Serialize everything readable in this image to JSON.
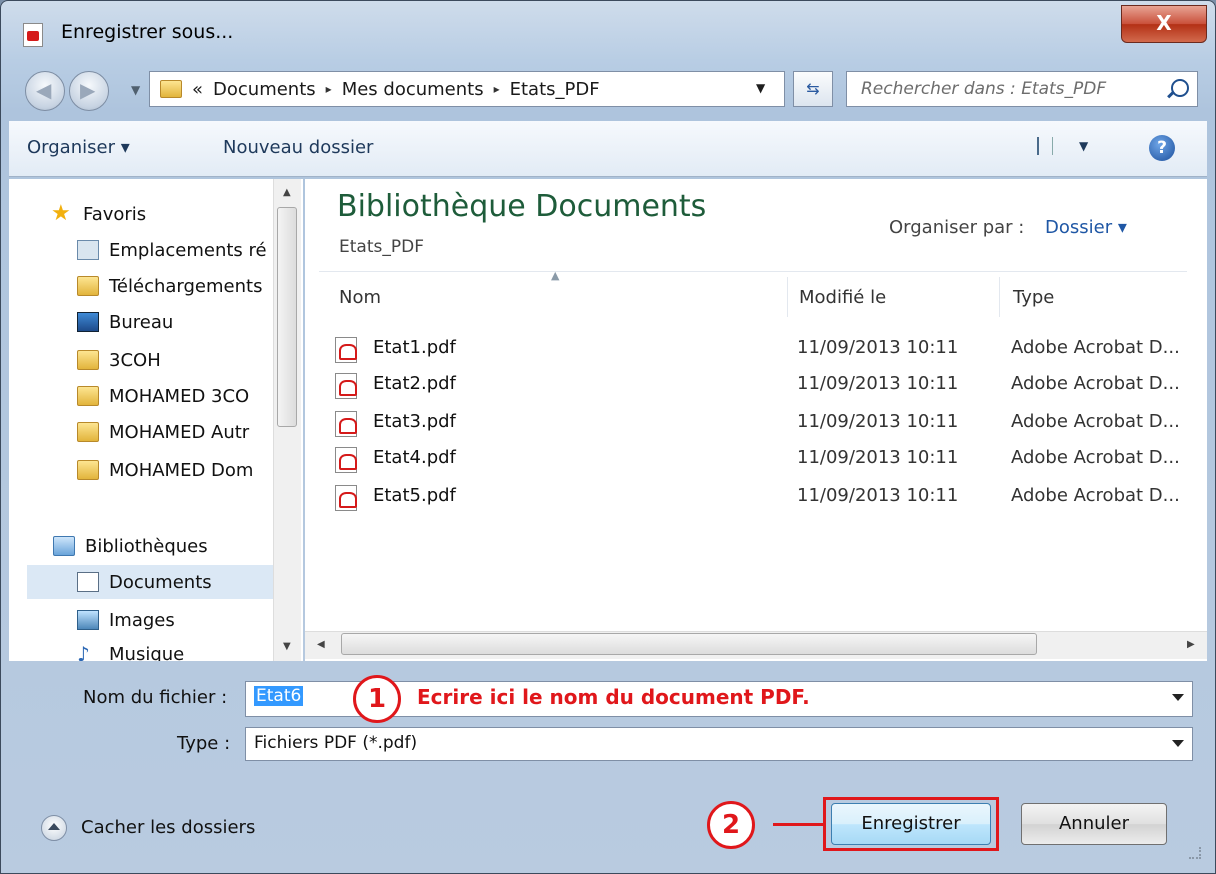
{
  "window": {
    "title": "Enregistrer sous...",
    "close_label": "X"
  },
  "address": {
    "crumbs": [
      "«",
      "Documents",
      "Mes documents",
      "Etats_PDF"
    ],
    "separator": "▸"
  },
  "search": {
    "placeholder": "Rechercher dans : Etats_PDF"
  },
  "toolbar": {
    "organise": "Organiser ▾",
    "new_folder": "Nouveau dossier",
    "help": "?"
  },
  "nav": {
    "items": [
      {
        "label": "Favoris",
        "icon": "star-icon"
      },
      {
        "label": "Emplacements ré",
        "icon": "recent-places-icon"
      },
      {
        "label": "Téléchargements",
        "icon": "downloads-folder-icon"
      },
      {
        "label": "Bureau",
        "icon": "desktop-icon"
      },
      {
        "label": "3COH",
        "icon": "folder-icon"
      },
      {
        "label": "MOHAMED 3CO",
        "icon": "folder-icon"
      },
      {
        "label": "MOHAMED Autr",
        "icon": "folder-icon"
      },
      {
        "label": "MOHAMED Dom",
        "icon": "folder-icon"
      },
      {
        "label": "Bibliothèques",
        "icon": "libraries-icon"
      },
      {
        "label": "Documents",
        "icon": "documents-icon"
      },
      {
        "label": "Images",
        "icon": "images-icon"
      },
      {
        "label": "Musique",
        "icon": "music-icon"
      }
    ]
  },
  "library": {
    "title": "Bibliothèque Documents",
    "subtitle": "Etats_PDF",
    "arrange_label": "Organiser par :",
    "arrange_value": "Dossier ▾"
  },
  "columns": {
    "name": "Nom",
    "modified": "Modifié le",
    "type": "Type"
  },
  "files": [
    {
      "name": "Etat1.pdf",
      "modified": "11/09/2013 10:11",
      "type": "Adobe Acrobat D..."
    },
    {
      "name": "Etat2.pdf",
      "modified": "11/09/2013 10:11",
      "type": "Adobe Acrobat D..."
    },
    {
      "name": "Etat3.pdf",
      "modified": "11/09/2013 10:11",
      "type": "Adobe Acrobat D..."
    },
    {
      "name": "Etat4.pdf",
      "modified": "11/09/2013 10:11",
      "type": "Adobe Acrobat D..."
    },
    {
      "name": "Etat5.pdf",
      "modified": "11/09/2013 10:11",
      "type": "Adobe Acrobat D..."
    }
  ],
  "form": {
    "filename_label": "Nom du fichier :",
    "filename_value": "Etat6",
    "type_label": "Type :",
    "type_value": "Fichiers PDF (*.pdf)"
  },
  "annotations": {
    "step1_number": "1",
    "step1_text": "Ecrire ici le nom du document PDF.",
    "step2_number": "2",
    "color": "#e0171b"
  },
  "footer": {
    "hide_folders": "Cacher les dossiers",
    "save": "Enregistrer",
    "cancel": "Annuler"
  }
}
